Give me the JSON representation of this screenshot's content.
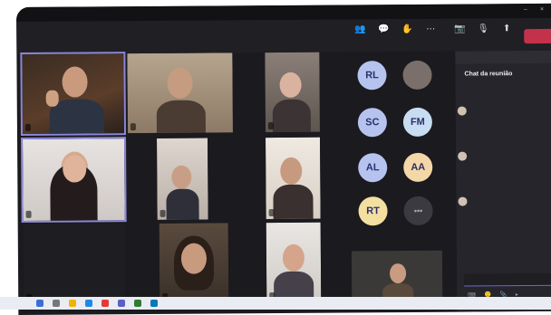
{
  "window": {
    "title": "",
    "controls": [
      "–",
      "×"
    ]
  },
  "toolbar": {
    "left_label": "⁣",
    "buttons": [
      {
        "icon": "people-icon",
        "glyph": "👥",
        "label": ""
      },
      {
        "icon": "chat-icon",
        "glyph": "💬",
        "label": ""
      },
      {
        "icon": "hand-icon",
        "glyph": "✋",
        "label": ""
      },
      {
        "icon": "more-icon",
        "glyph": "⋯",
        "label": ""
      },
      {
        "icon": "camera-icon",
        "glyph": "📷",
        "label": ""
      },
      {
        "icon": "mic-icon",
        "glyph": "🎙",
        "label": ""
      },
      {
        "icon": "share-icon",
        "glyph": "⬆",
        "label": ""
      }
    ],
    "leave_label": ""
  },
  "participants_grid": [
    {
      "name": ""
    },
    {
      "name": ""
    },
    {
      "name": ""
    },
    {
      "name": ""
    },
    {
      "name": ""
    },
    {
      "name": ""
    },
    {
      "name": ""
    },
    {
      "name": ""
    },
    {
      "name": ""
    }
  ],
  "avatars": [
    {
      "initials": "RL",
      "name": "",
      "color": "#b6c3ef"
    },
    {
      "initials": "",
      "name": "",
      "color": "#7a6f6a"
    },
    {
      "initials": "SC",
      "name": "",
      "color": "#b6c3ef"
    },
    {
      "initials": "FM",
      "name": "",
      "color": "#c8dcf2"
    },
    {
      "initials": "AL",
      "name": "",
      "color": "#b6c3ef"
    },
    {
      "initials": "AA",
      "name": "",
      "color": "#f3d7a6"
    },
    {
      "initials": "RT",
      "name": "",
      "color": "#f3e0a0"
    },
    {
      "initials": "•••",
      "name": "",
      "color": "#3b3a40"
    }
  ],
  "chat": {
    "header": "Chat da reunião",
    "messages": [
      {
        "meta": "",
        "text": ""
      },
      {
        "meta": "",
        "text": ""
      },
      {
        "meta": "",
        "text": ""
      }
    ],
    "compose_placeholder": "",
    "tools": "⌨ 🙂 📎 ▸"
  },
  "colors": {
    "accent": "#8b87d8",
    "leave": "#c4314b",
    "background": "#1b1a1f"
  }
}
